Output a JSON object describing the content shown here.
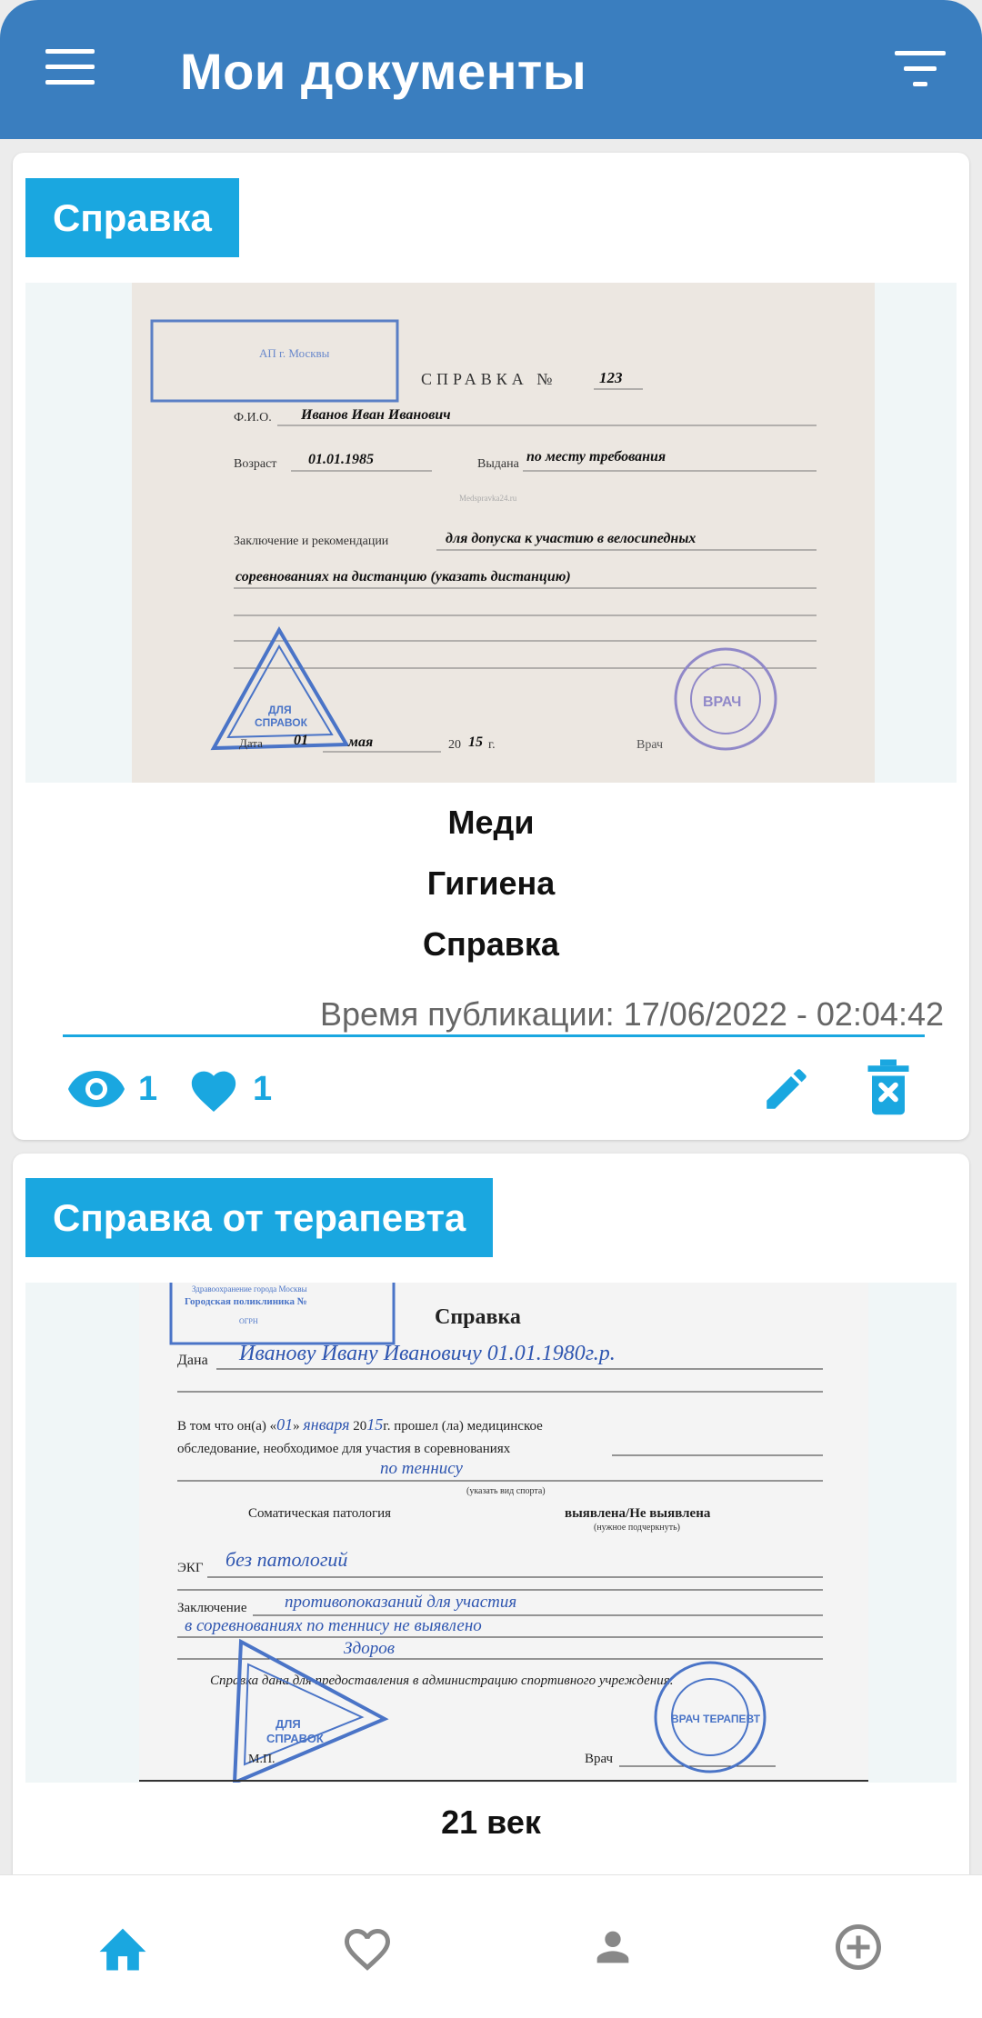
{
  "header": {
    "title": "Мои документы"
  },
  "posts": [
    {
      "tag": "Справка",
      "lines": [
        "Меди",
        "Гигиена",
        "Справка"
      ],
      "published_label": "Время публикации:",
      "published_value": "17/06/2022 - 02:04:42",
      "views": "1",
      "likes": "1",
      "doc": {
        "stamp_line1": "АП г. Москвы",
        "heading": "СПРАВКА №",
        "number": "123",
        "fio_label": "Ф.И.О.",
        "fio": "Иванов Иван Иванович",
        "age_label": "Возраст",
        "dob": "01.01.1985",
        "issued_label": "Выдана",
        "issued": "по месту требования",
        "watermark": "Medspravka24.ru",
        "conclusion_label": "Заключение и рекомендации",
        "conclusion1": "для допуска к участию в велосипедных",
        "conclusion2": "соревнованиях на дистанцию (указать дистанцию)",
        "date_label": "Дата",
        "day": "01",
        "month": "мая",
        "year_prefix": "20",
        "year": "15",
        "year_suffix": "г.",
        "doctor_label": "Врач",
        "triangle_text1": "ДЛЯ",
        "triangle_text2": "СПРАВОК",
        "seal_text": "ВРАЧ"
      }
    },
    {
      "tag": "Справка от терапевта",
      "lines": [
        "21 век"
      ],
      "doc": {
        "stamp_line1": "Здравоохранение города Москвы",
        "stamp_line2": "Городская поликлиника №",
        "stamp_line3": "ОГРН",
        "heading": "Справка",
        "given_label": "Дана",
        "given_hw": "Иванову Ивану Ивановичу 01.01.1980г.р.",
        "text1a": "В том что он(а) «",
        "text1_day": "01",
        "text1b": "» ",
        "text1_month": "января",
        "text1c": " 20",
        "text1_year": "15",
        "text1d": "г. прошел (ла) медицинское",
        "text2": "обследование, необходимое для участия в соревнованиях",
        "sport_hw": "по теннису",
        "sport_note": "(указать вид спорта)",
        "somatic_label": "Соматическая патология",
        "somatic_value": "выявлена/Не выявлена",
        "somatic_note": "(нужное подчеркнуть)",
        "ekg_label": "ЭКГ",
        "ekg_hw": "без патологий",
        "conclusion_label": "Заключение",
        "conclusion_hw1": "противопоказаний для участия",
        "conclusion_hw2": "в соревнованиях по теннису не выявлено",
        "conclusion_hw3": "Здоров",
        "footer_note": "Справка дана для предоставления в администрацию спортивного учреждения.",
        "mp_label": "М.П.",
        "doctor_label": "Врач",
        "triangle_text1": "ДЛЯ",
        "triangle_text2": "СПРАВОК",
        "seal_text": "ВРАЧ ТЕРАПЕВТ"
      }
    }
  ],
  "nav": [
    "home-icon",
    "heart-icon",
    "person-icon",
    "add-circle-icon"
  ],
  "colors": {
    "appbar": "#3a7ebf",
    "accent": "#1aa7e0",
    "nav_active": "#1aa7e0",
    "nav_inactive": "#888888"
  }
}
